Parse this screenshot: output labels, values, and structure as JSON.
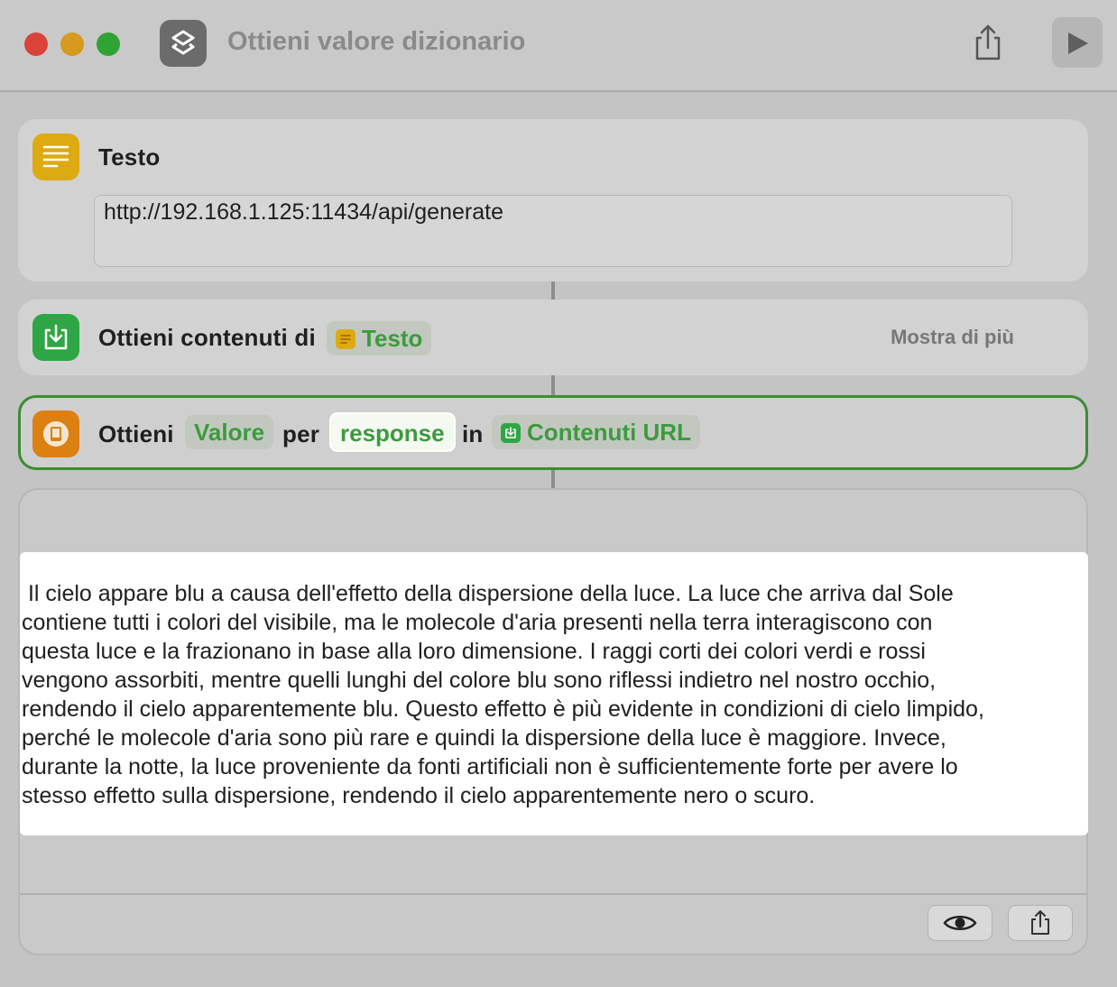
{
  "window": {
    "title": "Ottieni valore dizionario"
  },
  "actions": [
    {
      "name": "Testo",
      "value": "http://192.168.1.125:11434/api/generate",
      "icon": "text-lines-icon",
      "color": "#deaa12"
    },
    {
      "prefix": "Ottieni contenuti di",
      "input_token": "Testo",
      "more_label": "Mostra di più",
      "icon": "download-tray-icon",
      "color": "#2ea645"
    },
    {
      "prefix": "Ottieni",
      "value_token": "Valore",
      "for_word": "per",
      "key_token": "response",
      "in_word": "in",
      "source_token": "Contenuti URL",
      "icon": "book-icon",
      "color": "#dd8012"
    }
  ],
  "output": {
    "text": " Il cielo appare blu a causa dell'effetto della dispersione della luce. La luce che arriva dal Sole\ncontiene tutti i colori del visibile, ma le molecole d'aria presenti nella terra interagiscono con\nquesta luce e la frazionano in base alla loro dimensione. I raggi corti dei colori verdi e rossi\nvengono assorbiti, mentre quelli lunghi del colore blu sono riflessi indietro nel nostro occhio,\nrendendo il cielo apparentemente blu. Questo effetto è più evidente in condizioni di cielo limpido,\nperché le molecole d'aria sono più rare e quindi la dispersione della luce è maggiore. Invece,\ndurante la notte, la luce proveniente da fonti artificiali non è sufficientemente forte per avere lo\nstesso effetto sulla dispersione, rendendo il cielo apparentemente nero o scuro."
  },
  "colors": {
    "accent_green": "#3c9b3c",
    "selection_border": "#3d8c36"
  }
}
